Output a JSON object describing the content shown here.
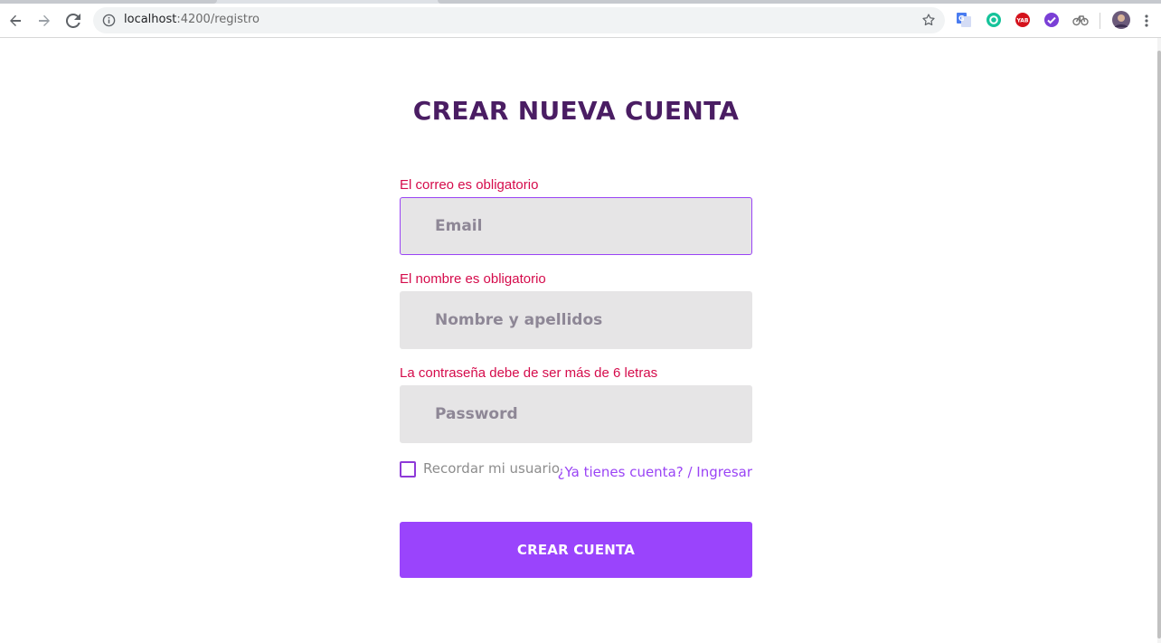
{
  "browser": {
    "url_host": "localhost",
    "url_rest": ":4200/registro",
    "icons": {
      "back": "arrow-left-icon",
      "forward": "arrow-right-icon",
      "reload": "reload-icon",
      "info": "info-icon",
      "bookmark": "star-icon",
      "menu": "kebab-menu-icon"
    },
    "extensions": [
      "google-translate-icon",
      "grammarly-icon",
      "yab-icon",
      "checkmark-icon",
      "bike-icon",
      "profile-avatar-icon"
    ],
    "ext_labels": {
      "yab": "YAB"
    }
  },
  "form": {
    "title": "CREAR NUEVA CUENTA",
    "email": {
      "error": "El correo es obligatorio",
      "placeholder": "Email",
      "value": ""
    },
    "name": {
      "error": "El nombre es obligatorio",
      "placeholder": "Nombre y apellidos",
      "value": ""
    },
    "password": {
      "error": "La contraseña debe de ser más de 6 letras",
      "placeholder": "Password",
      "value": ""
    },
    "remember_label": "Recordar mi usuario",
    "remember_checked": false,
    "login_link": "¿Ya tienes cuenta? / Ingresar",
    "submit_label": "CREAR CUENTA"
  },
  "colors": {
    "title": "#4a1d63",
    "error": "#d50b4b",
    "accent": "#9a44fc",
    "field_bg": "#e6e5e6"
  }
}
